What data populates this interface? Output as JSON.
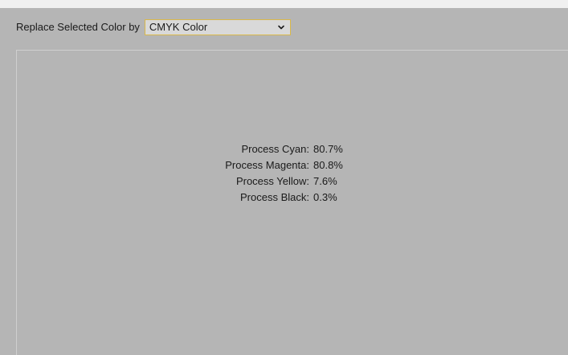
{
  "header": {
    "label": "Replace Selected Color by",
    "select_value": "CMYK Color"
  },
  "color_info": [
    {
      "label": "Process Cyan:",
      "value": "80.7%"
    },
    {
      "label": "Process Magenta:",
      "value": "80.8%"
    },
    {
      "label": "Process Yellow:",
      "value": "7.6%"
    },
    {
      "label": "Process Black:",
      "value": "0.3%"
    }
  ],
  "colors": {
    "background": "#b5b5b5",
    "select_border": "#d9b84a"
  },
  "icons": {
    "select_arrow": "chevron-down-icon"
  }
}
